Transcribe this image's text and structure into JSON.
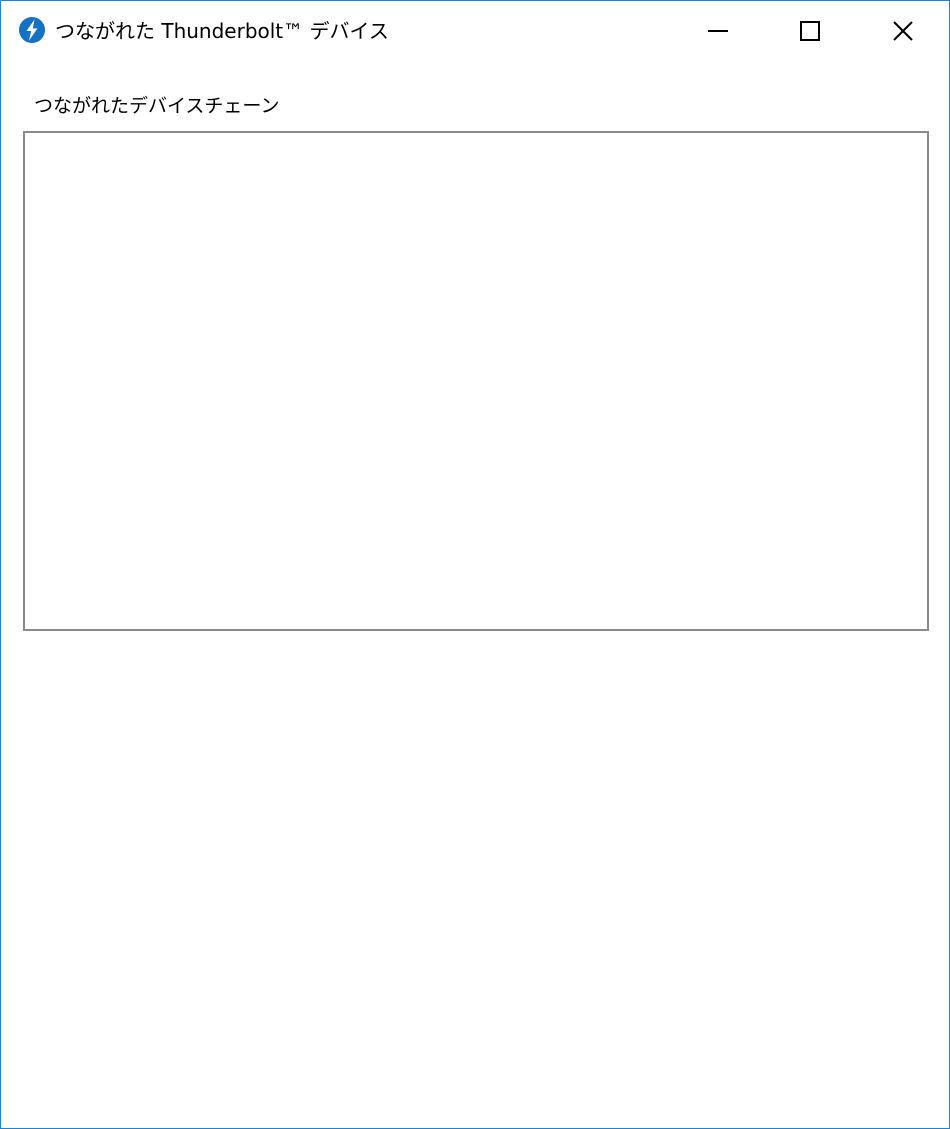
{
  "window": {
    "title": "つながれた Thunderbolt™ デバイス",
    "icon": "thunderbolt-icon",
    "border_color": "#1883d7",
    "icon_color": "#1572c3",
    "controls": {
      "minimize_icon": "minimize-icon",
      "maximize_icon": "maximize-icon",
      "close_icon": "close-icon"
    }
  },
  "main": {
    "section_label": "つながれたデバイスチェーン",
    "device_chain_items": []
  }
}
